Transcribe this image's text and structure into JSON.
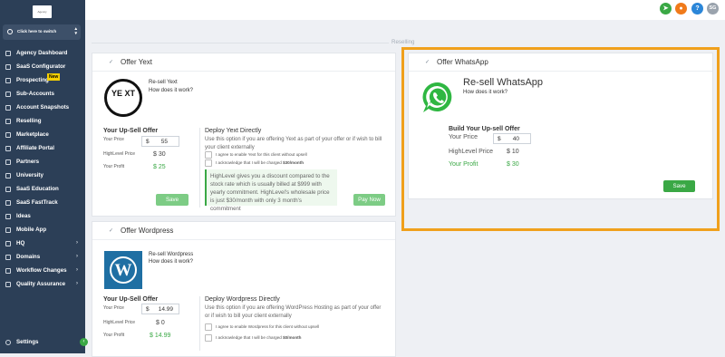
{
  "sidebar": {
    "logo_text": "Agency",
    "switch_label": "Click here to switch",
    "items": [
      {
        "label": "Agency Dashboard",
        "icon": "dashboard-icon"
      },
      {
        "label": "SaaS Configurator",
        "icon": "configurator-icon"
      },
      {
        "label": "Prospecting",
        "icon": "prospecting-icon",
        "badge": "New"
      },
      {
        "label": "Sub-Accounts",
        "icon": "sub-accounts-icon"
      },
      {
        "label": "Account Snapshots",
        "icon": "snapshots-icon"
      },
      {
        "label": "Reselling",
        "icon": "reselling-icon"
      },
      {
        "label": "Marketplace",
        "icon": "marketplace-icon"
      },
      {
        "label": "Affiliate Portal",
        "icon": "affiliate-icon"
      },
      {
        "label": "Partners",
        "icon": "partners-icon"
      },
      {
        "label": "University",
        "icon": "university-icon"
      },
      {
        "label": "SaaS Education",
        "icon": "education-icon"
      },
      {
        "label": "SaaS FastTrack",
        "icon": "fasttrack-icon"
      },
      {
        "label": "Ideas",
        "icon": "ideas-icon"
      },
      {
        "label": "Mobile App",
        "icon": "mobile-icon"
      },
      {
        "label": "HQ",
        "icon": "hq-icon",
        "chevron": true
      },
      {
        "label": "Domains",
        "icon": "domains-icon",
        "chevron": true
      },
      {
        "label": "Workflow Changes",
        "icon": "workflow-icon",
        "chevron": true
      },
      {
        "label": "Quality Assurance",
        "icon": "qa-icon",
        "chevron": true
      }
    ],
    "settings_label": "Settings"
  },
  "topbar": {
    "avatar_initials": "SG",
    "colors": {
      "megaphone": "#3aa845",
      "bell": "#f07a1a",
      "help": "#2b86d8",
      "avatar": "#9aa3ad"
    }
  },
  "section_label": "Reselling",
  "yext": {
    "header": "Offer Yext",
    "resell_title": "Re-sell Yext",
    "how_link": "How does it work?",
    "upsell_title": "Your Up-Sell Offer",
    "your_price_label": "Your Price",
    "currency": "$",
    "your_price": "55",
    "hl_price_label": "HighLevel Price",
    "hl_price": "$ 30",
    "profit_label": "Your Profit",
    "profit": "$ 25",
    "save_label": "Save",
    "deploy_title": "Deploy Yext Directly",
    "deploy_desc": "Use this option if you are offering Yext as part of your offer or if wish to bill your client externally",
    "agree_text": "I agree to enable Yext for this client without upsell",
    "ack_text_pre": "I acknowledge that I will be charged ",
    "ack_amount": "$30/month",
    "note": "HighLevel gives you a discount compared to the stock rate which is usually billed at $999 with yearly commitment. HighLevel's wholesale price is just $30/month with only 3 month's commitment",
    "pay_label": "Pay Now",
    "logo_text": "YE XT"
  },
  "wordpress": {
    "header": "Offer Wordpress",
    "resell_title": "Re-sell Wordpress",
    "how_link": "How does it work?",
    "upsell_title": "Your Up-Sell Offer",
    "your_price_label": "Your Price",
    "currency": "$",
    "your_price": "14.99",
    "hl_price_label": "HighLevel Price",
    "hl_price": "$ 0",
    "profit_label": "Your Profit",
    "profit": "$ 14.99",
    "deploy_title": "Deploy Wordpress Directly",
    "deploy_desc": "Use this option if you are offering WordPress Hosting as part of your offer or if wish to bill your client externally",
    "agree_text": "I agree to enable Wordpress for this client without upsell",
    "ack_text_pre": "I acknowledge that I will be charged ",
    "ack_amount": "$0/month",
    "logo_text": "W"
  },
  "whatsapp": {
    "header": "Offer WhatsApp",
    "resell_title": "Re-sell WhatsApp",
    "how_link": "How does it work?",
    "upsell_title": "Build Your Up-sell Offer",
    "your_price_label": "Your Price",
    "currency": "$",
    "your_price": "40",
    "hl_price_label": "HighLevel Price",
    "hl_price": "$ 10",
    "profit_label": "Your Profit",
    "profit": "$ 30",
    "save_label": "Save"
  }
}
